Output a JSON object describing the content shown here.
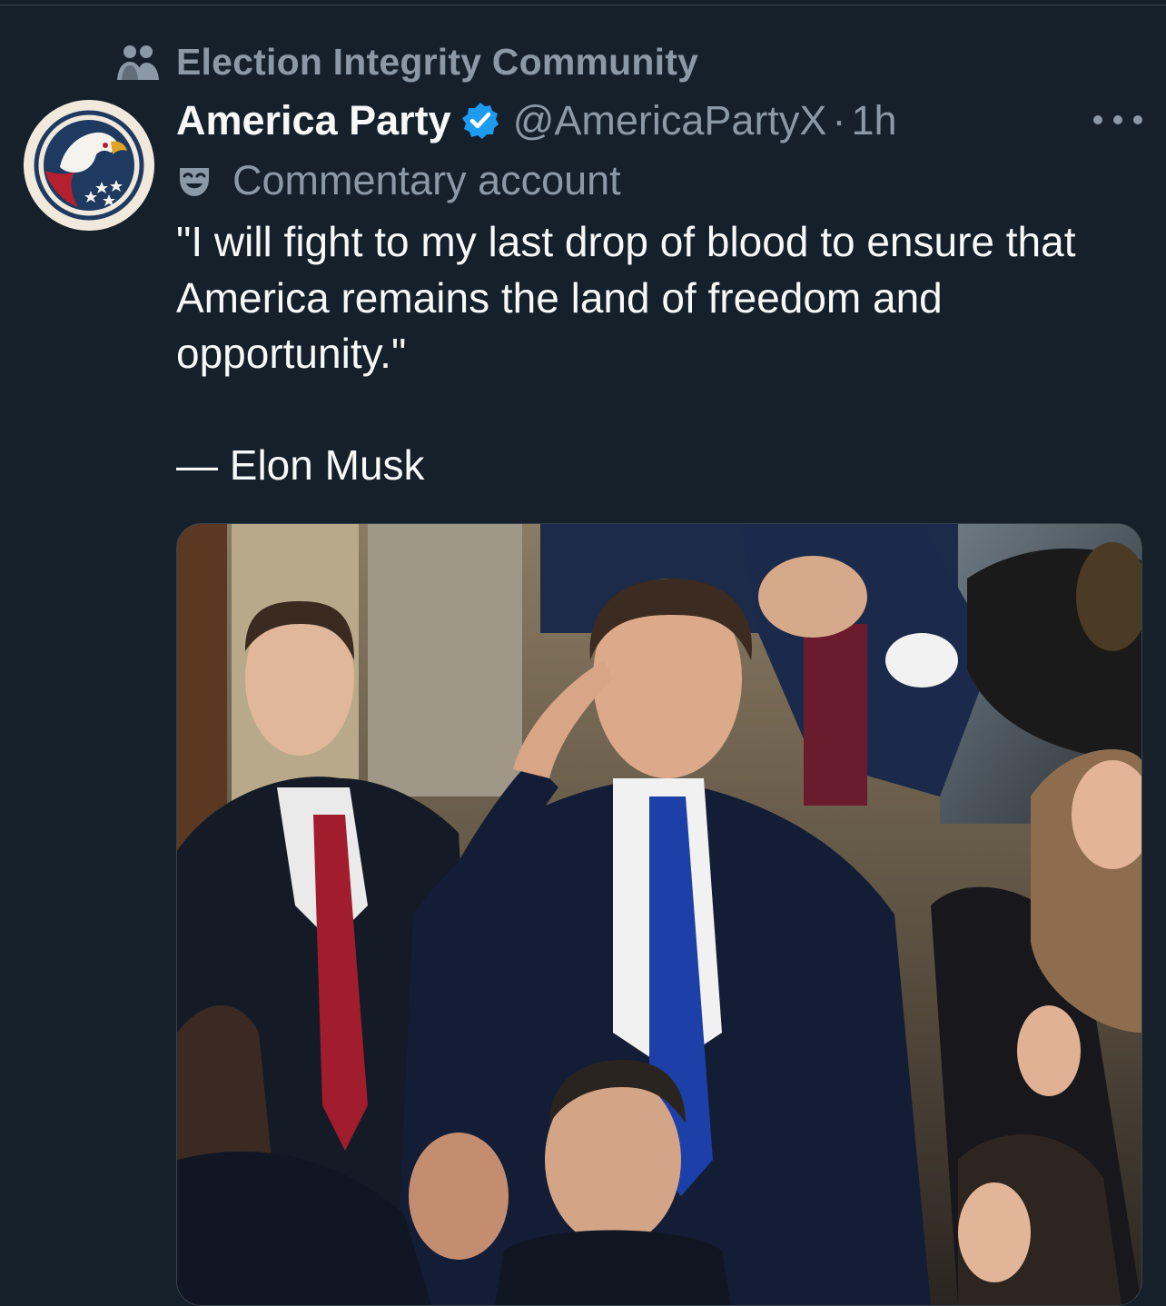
{
  "community": {
    "name": "Election Integrity Community",
    "icon": "community-icon"
  },
  "author": {
    "display_name": "America Party",
    "verified": true,
    "verified_icon": "verified-badge-icon",
    "handle": "@AmericaPartyX",
    "separator": "·",
    "time": "1h",
    "avatar_icon": "eagle-logo"
  },
  "account_label": {
    "icon": "mask-icon",
    "text": "Commentary account"
  },
  "tweet": {
    "quote": "\"I will fight to my last drop of blood to ensure that America remains the land of freedom and opportunity.\"",
    "attribution": "— Elon Musk"
  },
  "media": {
    "type": "photo",
    "alt": "photo"
  },
  "more_button": {
    "icon": "more-options-icon"
  },
  "colors": {
    "background": "#15202b",
    "primary_text": "#f7f9f9",
    "secondary_text": "#8b98a5",
    "verified_blue": "#1d9bf0",
    "divider": "#38444d"
  }
}
